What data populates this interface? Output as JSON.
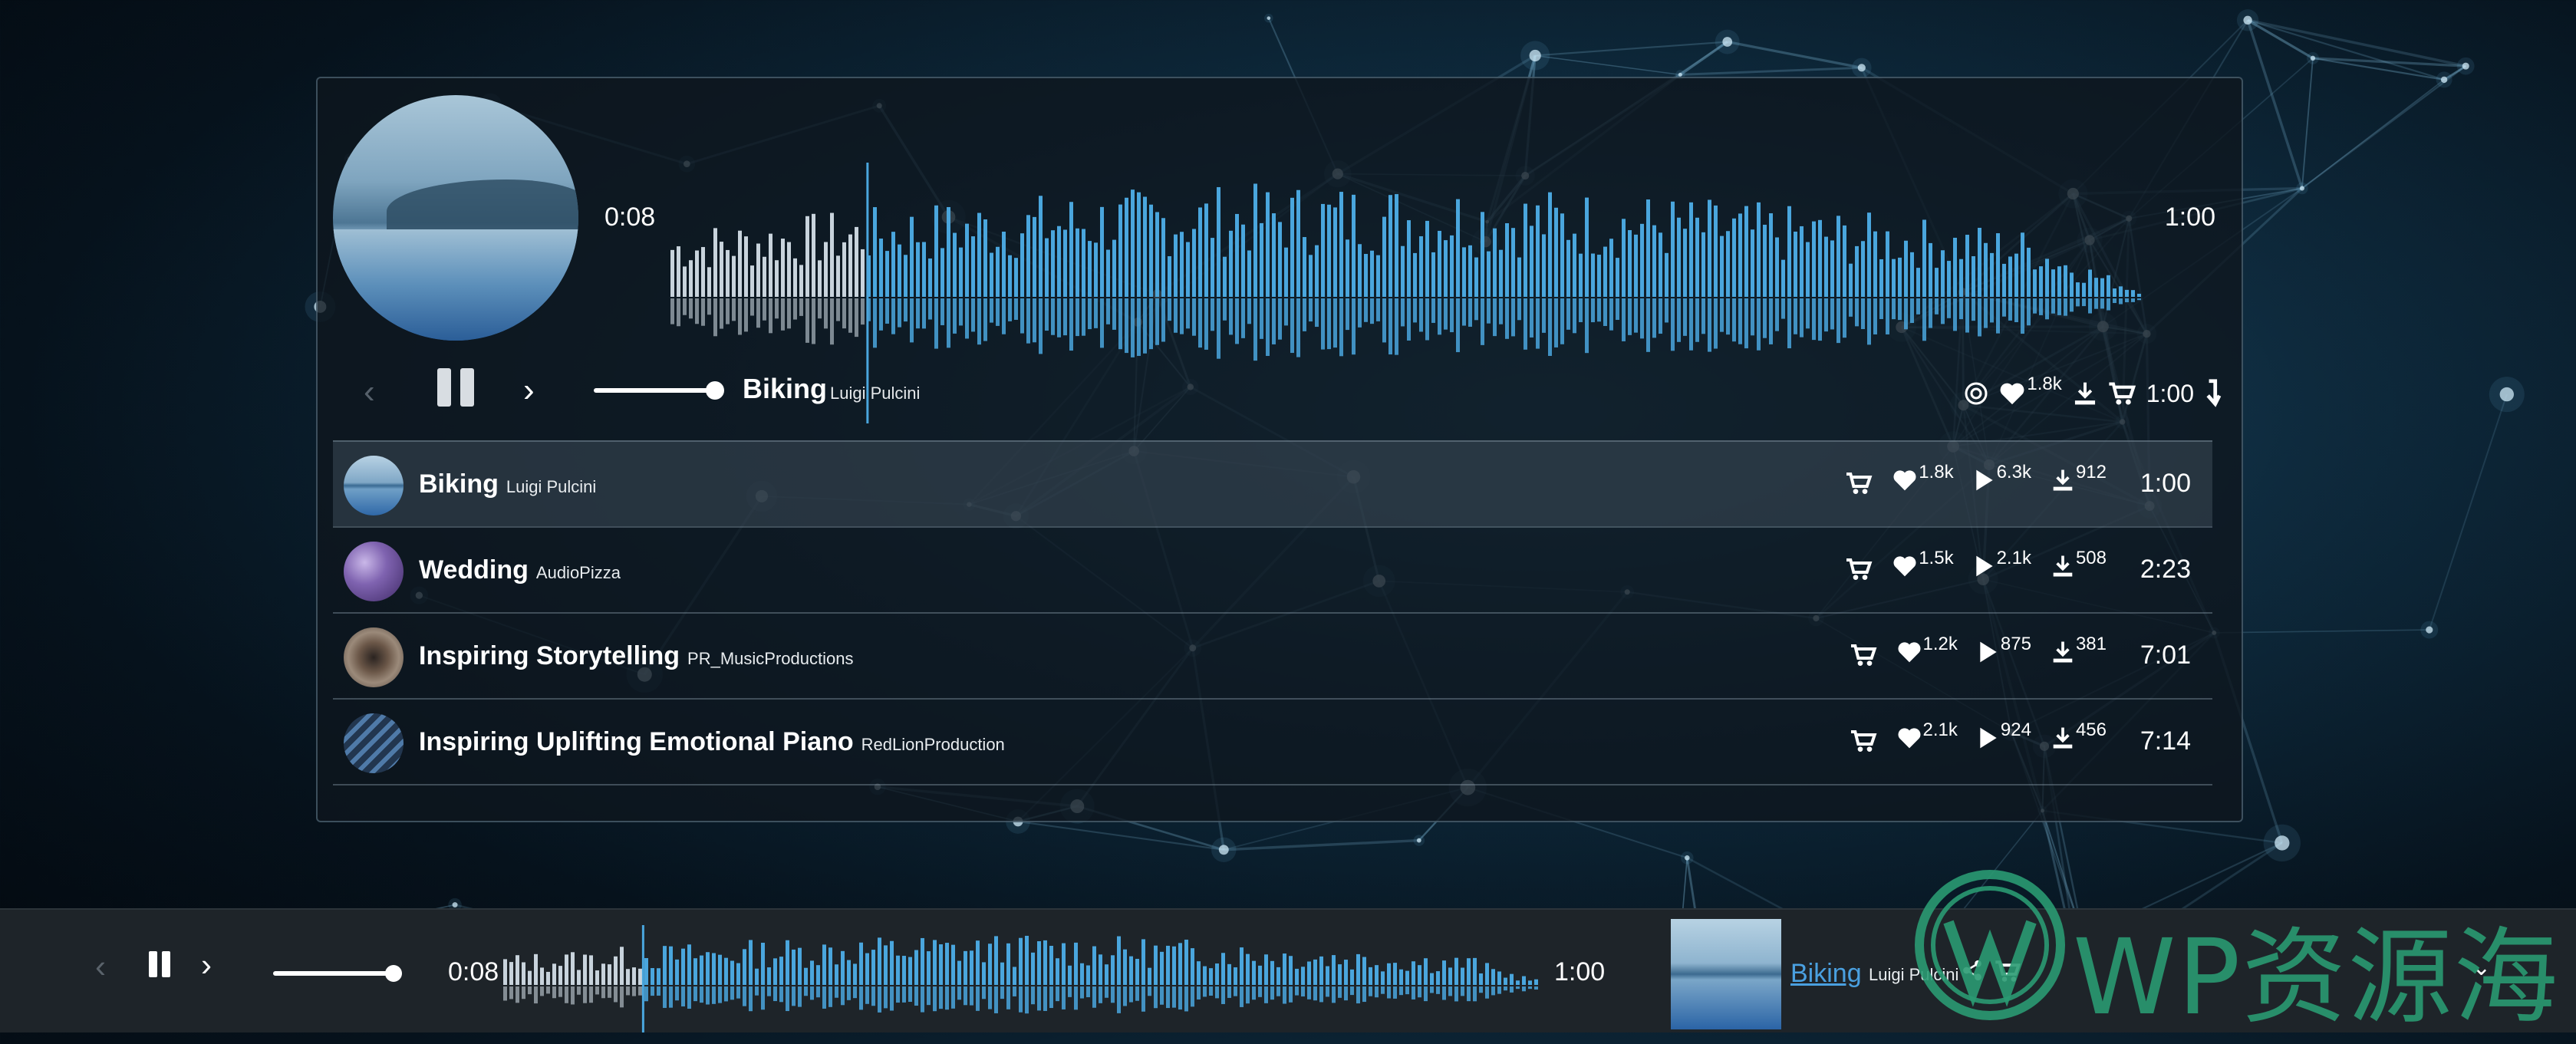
{
  "player": {
    "current_time": "0:08",
    "total_time": "1:00",
    "now_playing": {
      "title": "Biking",
      "artist": "Luigi Pulcini"
    },
    "likes": "1.8k",
    "duration": "1:00",
    "progress_fraction": 0.133,
    "volume_fraction": 1.0
  },
  "tracks": [
    {
      "title": "Biking",
      "artist": "Luigi Pulcini",
      "likes": "1.8k",
      "plays": "6.3k",
      "downloads": "912",
      "duration": "1:00",
      "active": true,
      "thumb": "lake-icon"
    },
    {
      "title": "Wedding",
      "artist": "AudioPizza",
      "likes": "1.5k",
      "plays": "2.1k",
      "downloads": "508",
      "duration": "2:23",
      "active": false,
      "thumb": "droplets-icon"
    },
    {
      "title": "Inspiring Storytelling",
      "artist": "PR_MusicProductions",
      "likes": "1.2k",
      "plays": "875",
      "downloads": "381",
      "duration": "7:01",
      "active": false,
      "thumb": "eye-icon"
    },
    {
      "title": "Inspiring Uplifting Emotional Piano",
      "artist": "RedLionProduction",
      "likes": "2.1k",
      "plays": "924",
      "downloads": "456",
      "duration": "7:14",
      "active": false,
      "thumb": "waves-icon"
    }
  ],
  "bottom_bar": {
    "current_time": "0:08",
    "total_time": "1:00",
    "title": "Biking",
    "artist": "Luigi Pulcini",
    "progress_fraction": 0.133
  },
  "watermark": {
    "text": "WP资源海"
  },
  "colors": {
    "accent": "#4aa6dd",
    "played": "#c8d3dc",
    "link": "#4aa0e0",
    "watermark": "#2a9a72"
  }
}
